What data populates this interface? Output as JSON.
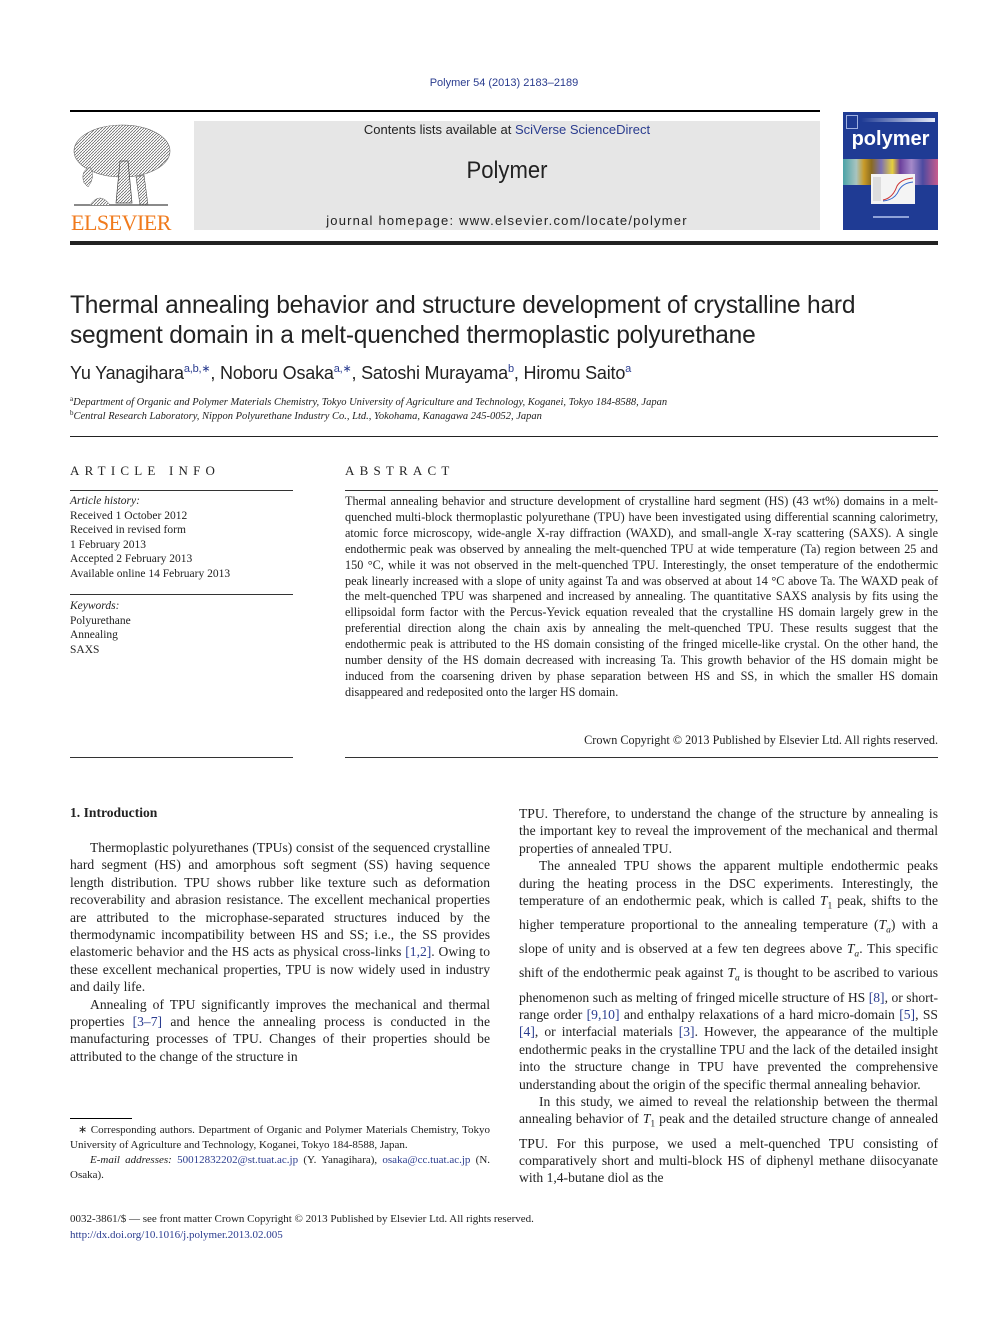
{
  "header": {
    "citation": "Polymer 54 (2013) 2183–2189",
    "contents_prefix": "Contents lists available at ",
    "contents_link": "SciVerse ScienceDirect",
    "journal_title": "Polymer",
    "homepage_prefix": "journal homepage: ",
    "homepage_url": "www.elsevier.com/locate/polymer",
    "publisher_logo_text": "ELSEVIER",
    "cover_title": "polymer",
    "colors": {
      "publisher_orange": "#f07a1c",
      "cover_blue": "#1f3b94",
      "link_blue": "#2a3c8f",
      "banner_gray": "#e6e6e6"
    }
  },
  "article": {
    "title_line1": "Thermal annealing behavior and structure development of crystalline hard",
    "title_line2": "segment domain in a melt-quenched thermoplastic polyurethane",
    "authors": [
      {
        "name": "Yu Yanagihara",
        "marks": "a,b,∗",
        "sep": ", "
      },
      {
        "name": "Noboru Osaka",
        "marks": "a,∗",
        "sep": ", "
      },
      {
        "name": "Satoshi Murayama",
        "marks": "b",
        "sep": ", "
      },
      {
        "name": "Hiromu Saito",
        "marks": "a",
        "sep": ""
      }
    ],
    "affiliations": [
      {
        "mark": "a",
        "text": "Department of Organic and Polymer Materials Chemistry, Tokyo University of Agriculture and Technology, Koganei, Tokyo 184-8588, Japan"
      },
      {
        "mark": "b",
        "text": "Central Research Laboratory, Nippon Polyurethane Industry Co., Ltd., Yokohama, Kanagawa 245-0052, Japan"
      }
    ]
  },
  "article_info": {
    "heading": "ARTICLE INFO",
    "history_label": "Article history:",
    "history": [
      "Received 1 October 2012",
      "Received in revised form",
      "1 February 2013",
      "Accepted 2 February 2013",
      "Available online 14 February 2013"
    ],
    "keywords_label": "Keywords:",
    "keywords": [
      "Polyurethane",
      "Annealing",
      "SAXS"
    ]
  },
  "abstract": {
    "heading": "ABSTRACT",
    "text": "Thermal annealing behavior and structure development of crystalline hard segment (HS) (43 wt%) domains in a melt-quenched multi-block thermoplastic polyurethane (TPU) have been investigated using differential scanning calorimetry, atomic force microscopy, wide-angle X-ray diffraction (WAXD), and small-angle X-ray scattering (SAXS). A single endothermic peak was observed by annealing the melt-quenched TPU at wide temperature (Ta) region between 25 and 150 °C, while it was not observed in the melt-quenched TPU. Interestingly, the onset temperature of the endothermic peak linearly increased with a slope of unity against Ta and was observed at about 14 °C above Ta. The WAXD peak of the melt-quenched TPU was sharpened and increased by annealing. The quantitative SAXS analysis by fits using the ellipsoidal form factor with the Percus-Yevick equation revealed that the crystalline HS domain largely grew in the preferential direction along the chain axis by annealing the melt-quenched TPU. These results suggest that the endothermic peak is attributed to the HS domain consisting of the fringed micelle-like crystal. On the other hand, the number density of the HS domain decreased with increasing Ta. This growth behavior of the HS domain might be induced from the coarsening driven by phase separation between HS and SS, in which the smaller HS domain disappeared and redeposited onto the larger HS domain.",
    "copyright": "Crown Copyright © 2013 Published by Elsevier Ltd. All rights reserved."
  },
  "body": {
    "section_heading": "1.  Introduction",
    "left_paragraphs": [
      "Thermoplastic polyurethanes (TPUs) consist of the sequenced crystalline hard segment (HS) and amorphous soft segment (SS) having sequence length distribution. TPU shows rubber like texture such as deformation recoverability and abrasion resistance. The excellent mechanical properties are attributed to the microphase-separated structures induced by the thermodynamic incompatibility between HS and SS; i.e., the SS provides elastomeric behavior and the HS acts as physical cross-links [1,2]. Owing to these excellent mechanical properties, TPU is now widely used in industry and daily life.",
      "Annealing of TPU significantly improves the mechanical and thermal properties [3–7] and hence the annealing process is conducted in the manufacturing processes of TPU. Changes of their properties should be attributed to the change of the structure in"
    ],
    "right_paragraphs": [
      "TPU. Therefore, to understand the change of the structure by annealing is the important key to reveal the improvement of the mechanical and thermal properties of annealed TPU.",
      "The annealed TPU shows the apparent multiple endothermic peaks during the heating process in the DSC experiments. Interestingly, the temperature of an endothermic peak, which is called T1 peak, shifts to the higher temperature proportional to the annealing temperature (Ta) with a slope of unity and is observed at a few ten degrees above Ta. This specific shift of the endothermic peak against Ta is thought to be ascribed to various phenomenon such as melting of fringed micelle structure of HS [8], or short-range order [9,10] and enthalpy relaxations of a hard micro-domain [5], SS [4], or interfacial materials [3]. However, the appearance of the multiple endothermic peaks in the crystalline TPU and the lack of the detailed insight into the structure change in TPU have prevented the comprehensive understanding about the origin of the specific thermal annealing behavior.",
      "In this study, we aimed to reveal the relationship between the thermal annealing behavior of T1 peak and the detailed structure change of annealed TPU. For this purpose, we used a melt-quenched TPU consisting of comparatively short and multi-block HS of diphenyl methane diisocyanate with 1,4-butane diol as the"
    ],
    "refs": {
      "r1": "[1,2]",
      "r2": "[3–7]",
      "r3": "[8]",
      "r4": "[9,10]",
      "r5": "[5]",
      "r6": "[4]",
      "r7": "[3]"
    }
  },
  "footnote": {
    "corresponding": "∗ Corresponding authors. Department of Organic and Polymer Materials Chemistry, Tokyo University of Agriculture and Technology, Koganei, Tokyo 184-8588, Japan.",
    "email_label": "E-mail addresses:",
    "email1": "50012832202@st.tuat.ac.jp",
    "email1_owner": "(Y. Yanagihara),",
    "email2": "osaka@cc.tuat.ac.jp",
    "email2_owner": "(N. Osaka)."
  },
  "footer": {
    "issn_line": "0032-3861/$ — see front matter Crown Copyright © 2013 Published by Elsevier Ltd. All rights reserved.",
    "doi": "http://dx.doi.org/10.1016/j.polymer.2013.02.005"
  }
}
